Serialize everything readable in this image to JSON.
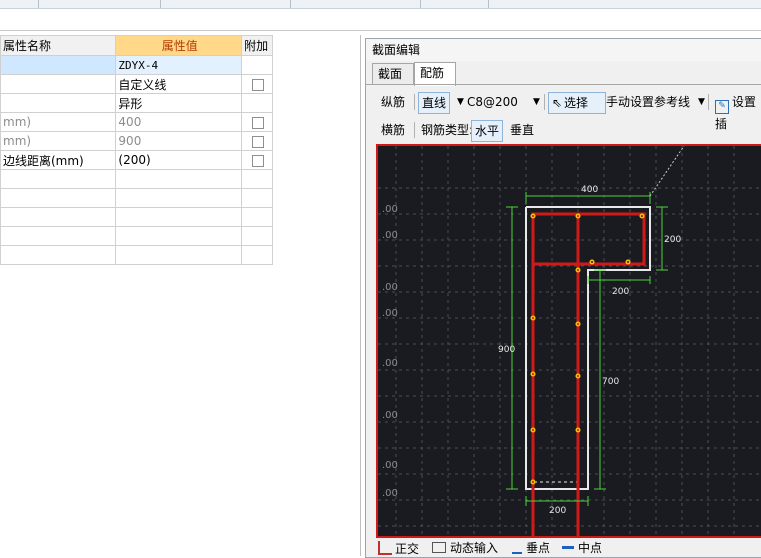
{
  "grid": {
    "headers": [
      "属性名称",
      "属性值",
      "附加"
    ],
    "rows": [
      {
        "name": "",
        "value": "ZDYX-4",
        "check": false
      },
      {
        "name": "",
        "value": "自定义线",
        "check": true
      },
      {
        "name": "",
        "value": "异形",
        "check": false
      },
      {
        "name": "mm)",
        "value": "400",
        "check": true
      },
      {
        "name": "mm)",
        "value": "900",
        "check": true
      },
      {
        "name": "边线距离(mm)",
        "value": "(200)",
        "check": true
      },
      {
        "name": "",
        "value": "",
        "check": false
      },
      {
        "name": "",
        "value": "",
        "check": false
      },
      {
        "name": "",
        "value": "",
        "check": false
      },
      {
        "name": "",
        "value": "",
        "check": false
      },
      {
        "name": "",
        "value": "",
        "check": false
      }
    ]
  },
  "editor": {
    "title": "截面编辑",
    "tabs": [
      "截面",
      "配筋"
    ],
    "toolbar1": {
      "longitudinal": "纵筋",
      "line_mode": "直线",
      "rebar_spec": "C8@200",
      "select": "选择",
      "manual_ref": "手动设置参考线",
      "settings": "设置插"
    },
    "toolbar2": {
      "transverse": "横筋",
      "rebar_type_label": "钢筋类型:",
      "horizontal": "水平",
      "vertical": "垂直"
    },
    "drawing": {
      "dims": [
        "400",
        "200",
        "200",
        "900",
        "700",
        "200"
      ],
      "grid_labels": [
        ".00",
        ".00",
        ".00",
        ".00",
        ".00",
        ".00",
        ".00",
        ".00"
      ]
    },
    "status": [
      "正交",
      "动态输入",
      "垂点",
      "中点"
    ]
  },
  "colors": {
    "accent_header": "#ffd88a",
    "canvas_bg": "#1a1b20",
    "rebar_red": "#d21919",
    "dim_green": "#4fd13d"
  }
}
